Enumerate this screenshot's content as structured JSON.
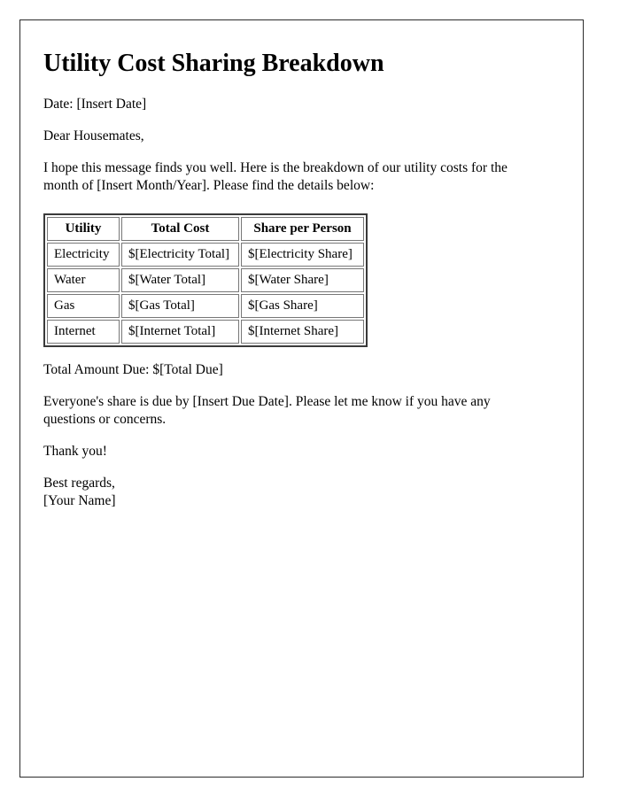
{
  "document": {
    "title": "Utility Cost Sharing Breakdown",
    "date_line": "Date: [Insert Date]",
    "salutation": "Dear Housemates,",
    "intro_paragraph": "I hope this message finds you well. Here is the breakdown of our utility costs for the month of [Insert Month/Year]. Please find the details below:",
    "total_due_line": "Total Amount Due: $[Total Due]",
    "due_paragraph": "Everyone's share is due by [Insert Due Date]. Please let me know if you have any questions or concerns.",
    "thanks_line": "Thank you!",
    "closing": "Best regards,",
    "signature_name": "[Your Name]"
  },
  "table": {
    "headers": [
      "Utility",
      "Total Cost",
      "Share per Person"
    ],
    "rows": [
      [
        "Electricity",
        "$[Electricity Total]",
        "$[Electricity Share]"
      ],
      [
        "Water",
        "$[Water Total]",
        "$[Water Share]"
      ],
      [
        "Gas",
        "$[Gas Total]",
        "$[Gas Share]"
      ],
      [
        "Internet",
        "$[Internet Total]",
        "$[Internet Share]"
      ]
    ]
  },
  "colors": {
    "text": "#000000",
    "page_border": "#2b2b2b",
    "table_outer_border": "#3a3a3a",
    "table_cell_border": "#777777",
    "background": "#ffffff"
  }
}
